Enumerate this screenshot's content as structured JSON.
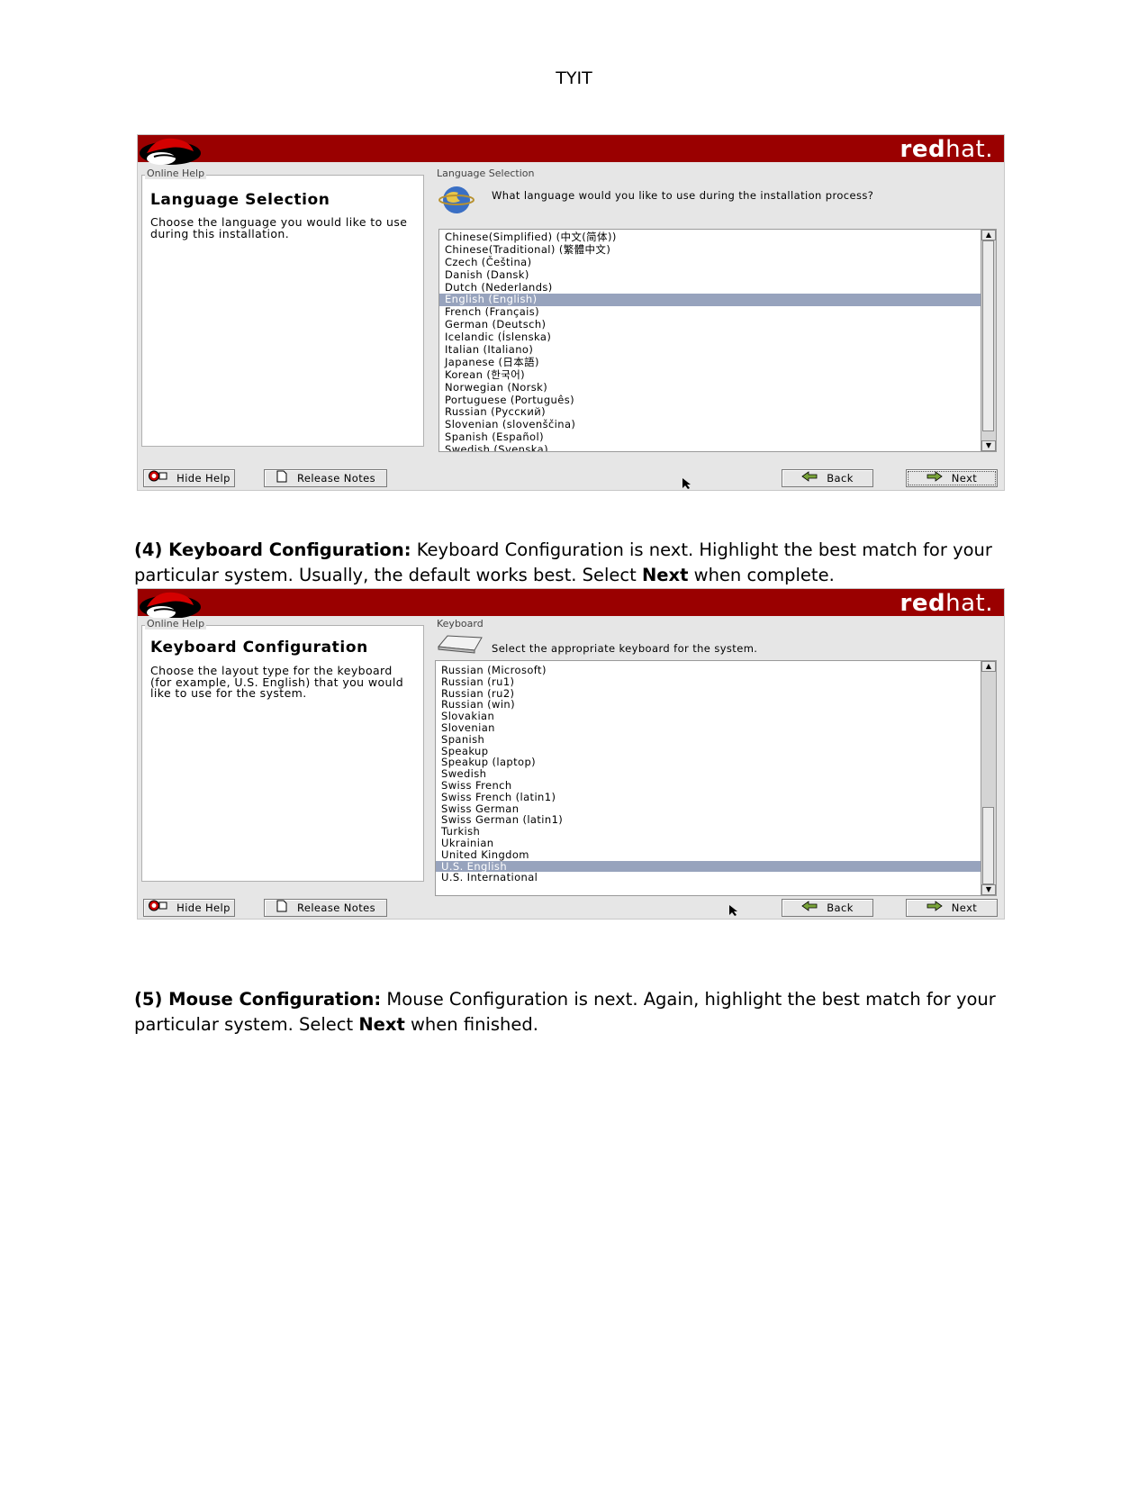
{
  "header": {
    "text": "TYIT"
  },
  "screenshot1": {
    "brand": {
      "bold": "red",
      "normal": "hat."
    },
    "help_frame_label": "Online Help",
    "help_title": "Language Selection",
    "help_body": "Choose the language you would like to use during this installation.",
    "main_frame_label": "Language Selection",
    "prompt": "What language would you like to use during the installation process?",
    "items": [
      "Chinese(Simplified) (中文(简体))",
      "Chinese(Traditional) (繁體中文)",
      "Czech (Čeština)",
      "Danish (Dansk)",
      "Dutch (Nederlands)",
      "English (English)",
      "French (Français)",
      "German (Deutsch)",
      "Icelandic (Íslenska)",
      "Italian (Italiano)",
      "Japanese (日本語)",
      "Korean (한국어)",
      "Norwegian (Norsk)",
      "Portuguese (Português)",
      "Russian (Русский)",
      "Slovenian (slovenščina)",
      "Spanish (Español)",
      "Swedish (Svenska)"
    ],
    "selected": "English (English)",
    "buttons": {
      "hide_help": "Hide Help",
      "release_notes": "Release Notes",
      "back": "Back",
      "next": "Next"
    }
  },
  "paragraph4": {
    "lead": "(4) Keyboard Configuration:",
    "text_a": " Keyboard Configuration is next. Highlight the best match for your particular system. Usually, the default works best. Select ",
    "bold_word": "Next",
    "text_b": " when complete."
  },
  "screenshot2": {
    "brand": {
      "bold": "red",
      "normal": "hat."
    },
    "help_frame_label": "Online Help",
    "help_title": "Keyboard Configuration",
    "help_body": "Choose the layout type for the keyboard (for example, U.S. English) that you would like to use for the system.",
    "main_frame_label": "Keyboard",
    "prompt": "Select the appropriate keyboard for the system.",
    "items": [
      "Russian (Microsoft)",
      "Russian (ru1)",
      "Russian (ru2)",
      "Russian (win)",
      "Slovakian",
      "Slovenian",
      "Spanish",
      "Speakup",
      "Speakup (laptop)",
      "Swedish",
      "Swiss French",
      "Swiss French (latin1)",
      "Swiss German",
      "Swiss German (latin1)",
      "Turkish",
      "Ukrainian",
      "United Kingdom",
      "U.S. English",
      "U.S. International"
    ],
    "selected": "U.S. English",
    "buttons": {
      "hide_help": "Hide Help",
      "release_notes": "Release Notes",
      "back": "Back",
      "next": "Next"
    }
  },
  "paragraph5": {
    "lead": "(5) Mouse Configuration:",
    "text_a": " Mouse Configuration is next. Again, highlight the best match for your particular system. Select ",
    "bold_word": "Next",
    "text_b": " when finished."
  },
  "colors": {
    "brand_red": "#9a0000",
    "selection": "#97a3bd",
    "panel": "#e6e6e6"
  }
}
